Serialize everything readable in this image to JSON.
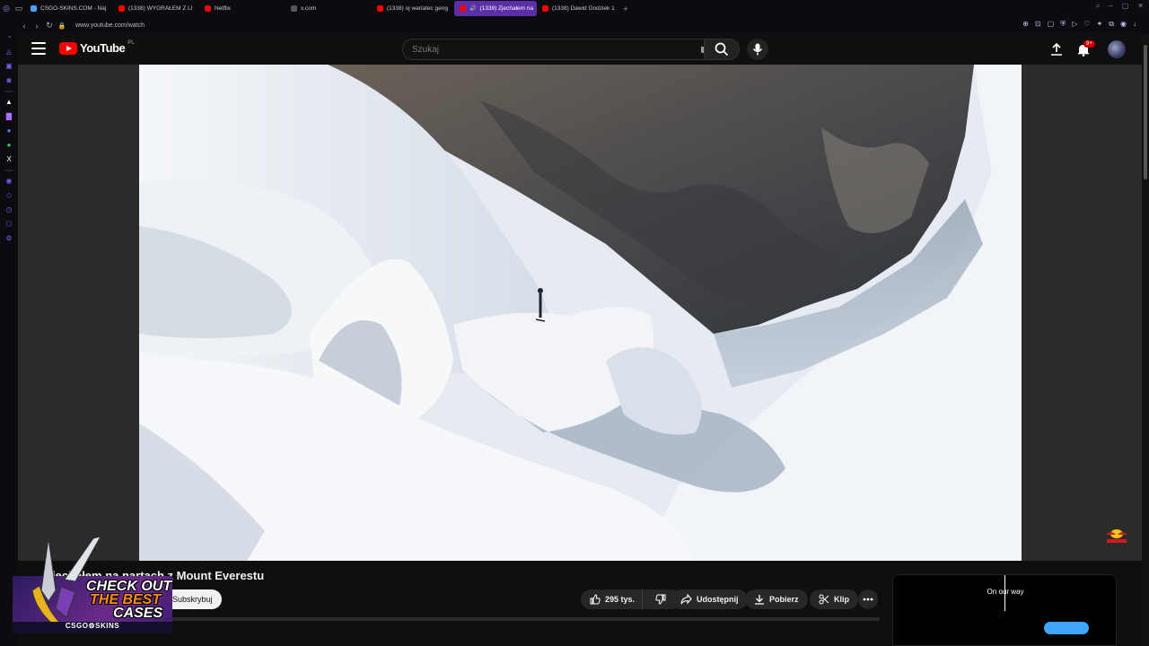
{
  "browser": {
    "tabs": [
      {
        "label": "CSGO-SKINS.COM - Naj",
        "color": "#4aa3ff",
        "active": false
      },
      {
        "label": "(1338) WYGRAŁEM Z LI",
        "color": "#ff0000",
        "active": false
      },
      {
        "label": "Netflix",
        "color": "#e50914",
        "active": false
      },
      {
        "label": "x.com",
        "color": "#444444",
        "active": false
      },
      {
        "label": "(1338) oj wariatec geng",
        "color": "#ff0000",
        "active": false
      },
      {
        "label": "(1338) Zjechałem na",
        "color": "#ff0000",
        "active": true
      },
      {
        "label": "(1338) Dawid Godziek 1",
        "color": "#ff0000",
        "active": false
      }
    ],
    "new_tab": "+",
    "url": "www.youtube.com/watch"
  },
  "youtube": {
    "logo_word": "YouTube",
    "country": "PL",
    "search_placeholder": "Szukaj",
    "notification_count": "9+"
  },
  "video": {
    "title": "Zjechałem na nartach z Mount Everestu",
    "subscribe_label": "Subskrybuj",
    "likes": "295 tys.",
    "share_label": "Udostępnij",
    "download_label": "Pobierz",
    "clip_label": "Klip"
  },
  "side_card": {
    "label": "On our way"
  },
  "ad": {
    "line1": "CHECK OUT",
    "line2": "THE BEST",
    "line3": "CASES",
    "brand": "CSGO⚙SKINS"
  },
  "colors": {
    "accent": "#5b2fa8",
    "yt_red": "#ff0000",
    "badge": "#cc0000"
  }
}
